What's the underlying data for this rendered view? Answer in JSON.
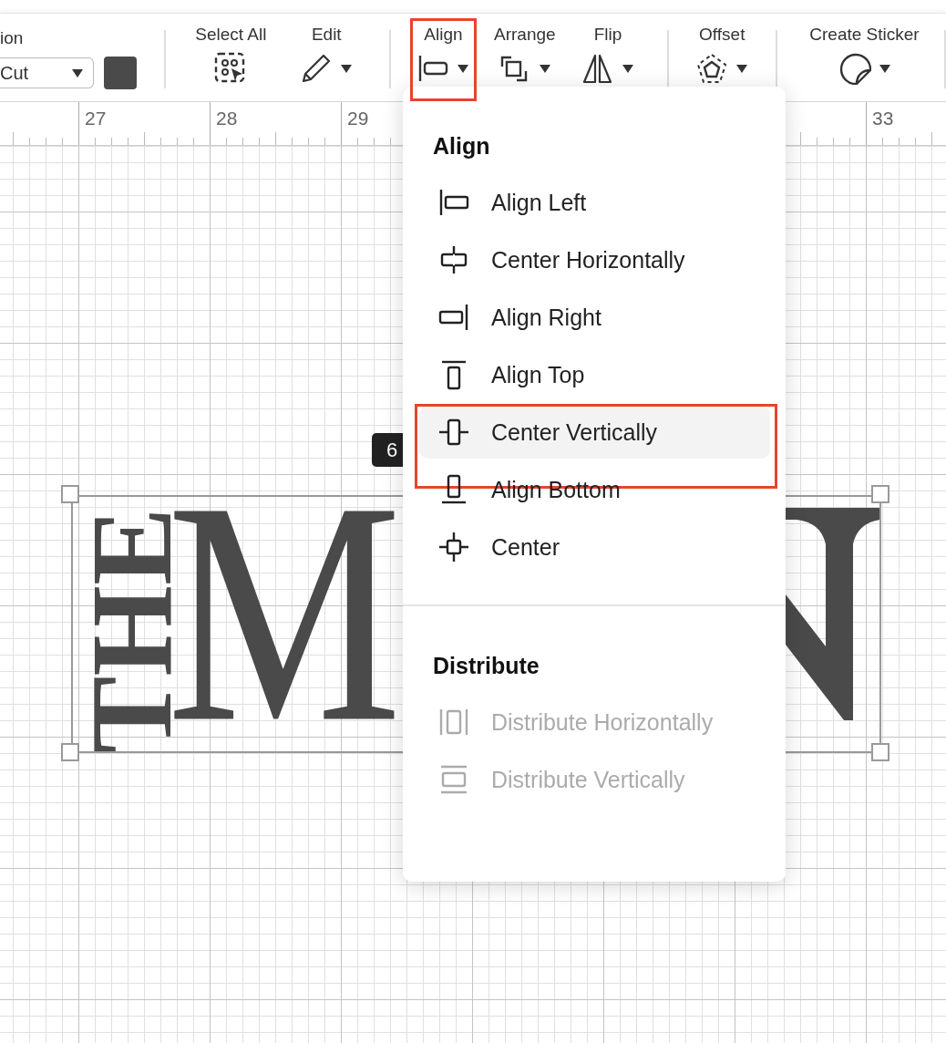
{
  "toolbar": {
    "operation": {
      "label": "ion",
      "value": "Cut"
    },
    "groups": [
      {
        "tools": [
          {
            "label": "Select All",
            "dropdown": false,
            "highlighted": false
          },
          {
            "label": "Edit",
            "dropdown": true,
            "highlighted": false
          }
        ]
      },
      {
        "tools": [
          {
            "label": "Align",
            "dropdown": true,
            "highlighted": true
          },
          {
            "label": "Arrange",
            "dropdown": true,
            "highlighted": false
          },
          {
            "label": "Flip",
            "dropdown": true,
            "highlighted": false
          }
        ]
      },
      {
        "tools": [
          {
            "label": "Offset",
            "dropdown": true,
            "highlighted": false
          }
        ]
      },
      {
        "tools": [
          {
            "label": "Create Sticker",
            "dropdown": true,
            "highlighted": false
          }
        ]
      }
    ]
  },
  "ruler": {
    "labels": [
      "27",
      "28",
      "29",
      "33"
    ]
  },
  "canvas": {
    "tooltip": "6",
    "design": {
      "vertical_text": "THE",
      "letters": [
        "M"
      ],
      "selected": true
    }
  },
  "menu": {
    "sections": [
      {
        "title": "Align",
        "items": [
          {
            "label": "Align Left",
            "selected": false,
            "disabled": false,
            "highlighted": false
          },
          {
            "label": "Center Horizontally",
            "selected": false,
            "disabled": false,
            "highlighted": false
          },
          {
            "label": "Align Right",
            "selected": false,
            "disabled": false,
            "highlighted": false
          },
          {
            "label": "Align Top",
            "selected": false,
            "disabled": false,
            "highlighted": false
          },
          {
            "label": "Center Vertically",
            "selected": true,
            "disabled": false,
            "highlighted": true
          },
          {
            "label": "Align Bottom",
            "selected": false,
            "disabled": false,
            "highlighted": false
          },
          {
            "label": "Center",
            "selected": false,
            "disabled": false,
            "highlighted": false
          }
        ]
      },
      {
        "title": "Distribute",
        "items": [
          {
            "label": "Distribute Horizontally",
            "selected": false,
            "disabled": true,
            "highlighted": false
          },
          {
            "label": "Distribute Vertically",
            "selected": false,
            "disabled": true,
            "highlighted": false
          }
        ]
      }
    ]
  }
}
